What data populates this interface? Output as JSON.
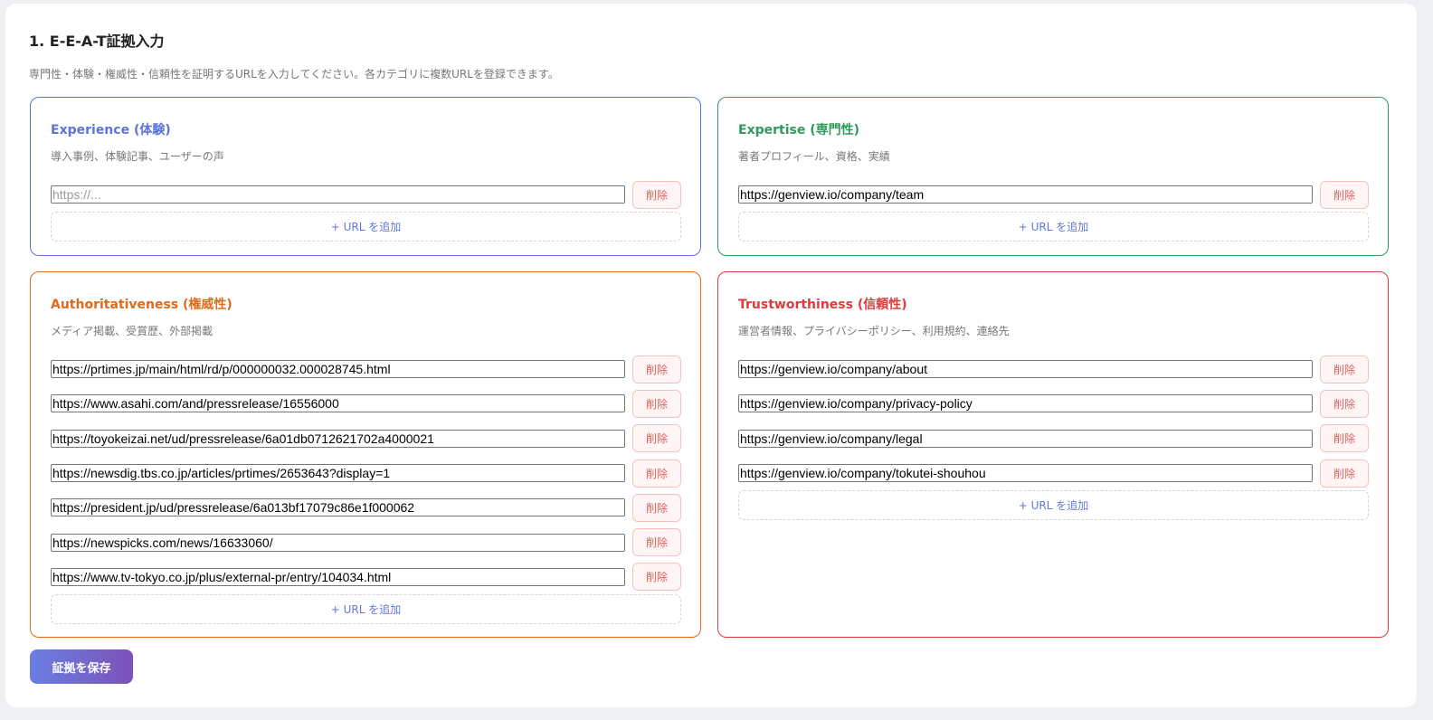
{
  "section": {
    "title": "1. E-E-A-T証拠入力",
    "description": "専門性・体験・権威性・信頼性を証明するURLを入力してください。各カテゴリに複数URLを登録できます。"
  },
  "colors": {
    "experience": "#5b73df",
    "expertise": "#2e9b5c",
    "authoritativeness": "#e06a1b",
    "trustworthiness": "#de3b3b"
  },
  "cards": {
    "experience": {
      "title": "Experience (体験)",
      "desc": "導入事例、体験記事、ユーザーの声",
      "placeholder": "https://...",
      "urls": [
        ""
      ]
    },
    "expertise": {
      "title": "Expertise (専門性)",
      "desc": "著者プロフィール、資格、実績",
      "urls": [
        "https://genview.io/company/team"
      ]
    },
    "authoritativeness": {
      "title": "Authoritativeness (権威性)",
      "desc": "メディア掲載、受賞歴、外部掲載",
      "urls": [
        "https://prtimes.jp/main/html/rd/p/000000032.000028745.html",
        "https://www.asahi.com/and/pressrelease/16556000",
        "https://toyokeizai.net/ud/pressrelease/6a01db0712621702a4000021",
        "https://newsdig.tbs.co.jp/articles/prtimes/2653643?display=1",
        "https://president.jp/ud/pressrelease/6a013bf17079c86e1f000062",
        "https://newspicks.com/news/16633060/",
        "https://www.tv-tokyo.co.jp/plus/external-pr/entry/104034.html"
      ]
    },
    "trustworthiness": {
      "title": "Trustworthiness (信頼性)",
      "desc": "運営者情報、プライバシーポリシー、利用規約、連絡先",
      "urls": [
        "https://genview.io/company/about",
        "https://genview.io/company/privacy-policy",
        "https://genview.io/company/legal",
        "https://genview.io/company/tokutei-shouhou"
      ]
    }
  },
  "labels": {
    "delete": "削除",
    "add_url": "+ URL を追加",
    "save": "証拠を保存"
  }
}
